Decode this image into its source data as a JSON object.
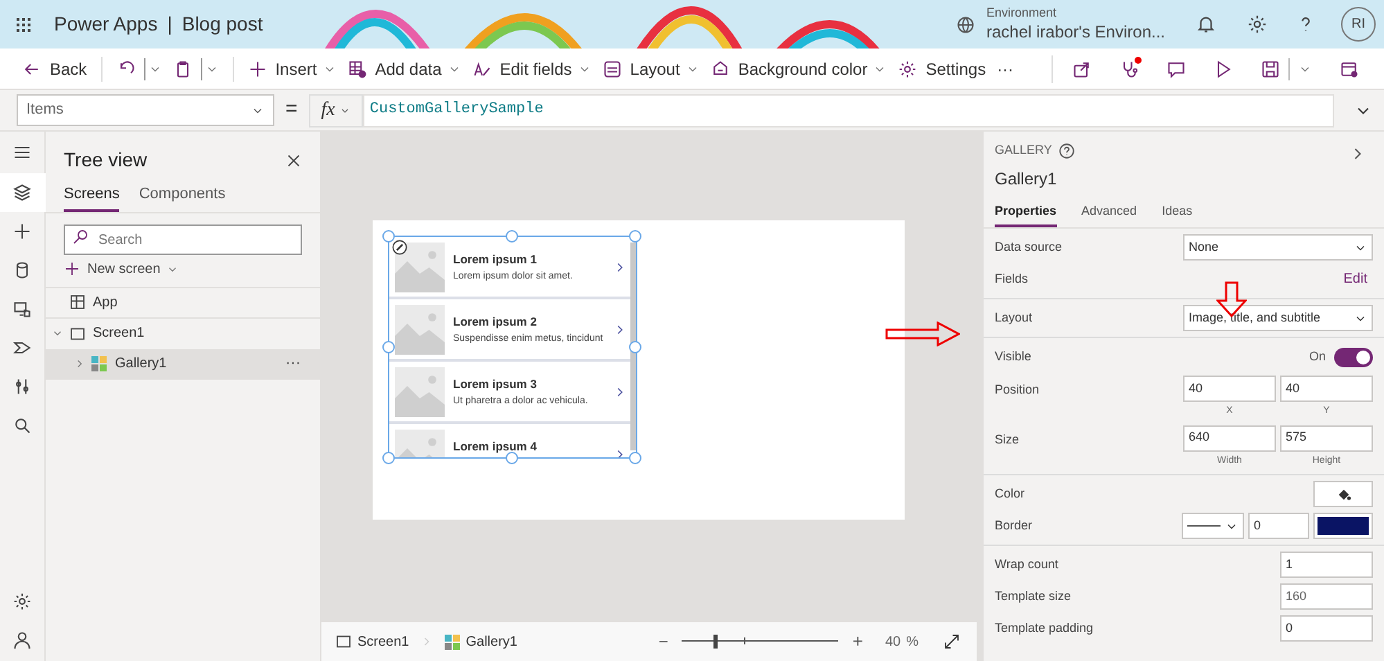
{
  "app_bar": {
    "app_name": "Power Apps",
    "separator": "|",
    "doc_title": "Blog post",
    "environment_label": "Environment",
    "environment_name": "rachel irabor's Environ...",
    "avatar_initials": "RI"
  },
  "toolbar": {
    "items": [
      {
        "label": "Back",
        "caret": false
      },
      {
        "caret": true
      },
      {
        "caret": true
      },
      {
        "label": "Insert",
        "caret": true
      },
      {
        "label": "Add data",
        "caret": true
      },
      {
        "label": "Edit fields",
        "caret": true
      },
      {
        "label": "Layout",
        "caret": true
      },
      {
        "label": "Background color",
        "caret": true
      },
      {
        "label": "Settings",
        "caret": false
      },
      {
        "label": "···",
        "caret": false
      }
    ]
  },
  "formula_bar": {
    "property": "Items",
    "equals": "=",
    "fx": "fx",
    "formula": "CustomGallerySample"
  },
  "left_rail": {
    "items": [
      {
        "selected": true
      },
      {
        "selected": false
      },
      {
        "selected": false
      },
      {
        "selected": false
      },
      {
        "selected": false
      },
      {
        "selected": false
      },
      {
        "selected": false
      }
    ]
  },
  "tree_view": {
    "title": "Tree view",
    "tabs": [
      {
        "label": "Screens",
        "selected": true
      },
      {
        "label": "Components",
        "selected": false
      }
    ],
    "search": {
      "placeholder": "Search"
    },
    "new_screen": "New screen",
    "nodes": [
      {
        "kind": "app",
        "label": "App",
        "selected": false
      },
      {
        "kind": "screen",
        "label": "Screen1",
        "selected": false,
        "expanded": true,
        "children": [
          {
            "kind": "gallery",
            "label": "Gallery1",
            "selected": true,
            "expanded": false,
            "more": "···"
          }
        ]
      }
    ]
  },
  "canvas": {
    "gallery_items": [
      {
        "title": "Lorem ipsum 1",
        "subtitle": "Lorem ipsum dolor sit amet."
      },
      {
        "title": "Lorem ipsum 2",
        "subtitle": "Suspendisse enim metus, tincidunt"
      },
      {
        "title": "Lorem ipsum 3",
        "subtitle": "Ut pharetra a dolor ac vehicula."
      },
      {
        "title": "Lorem ipsum 4"
      }
    ]
  },
  "properties_panel": {
    "type": "GALLERY",
    "name": "Gallery1",
    "tabs": [
      {
        "label": "Properties",
        "selected": true
      },
      {
        "label": "Advanced",
        "selected": false
      },
      {
        "label": "Ideas",
        "selected": false
      }
    ],
    "sections": [
      {
        "rows": [
          {
            "kind": "dropdown",
            "label": "Data source",
            "value": "None"
          },
          {
            "kind": "link",
            "label": "Fields",
            "link": "Edit"
          }
        ]
      },
      {
        "rows": [
          {
            "kind": "dropdown",
            "label": "Layout",
            "value": "Image, title, and subtitle"
          }
        ]
      },
      {
        "rows": [
          {
            "kind": "toggle",
            "label": "Visible",
            "state_text": "On",
            "on": true
          },
          {
            "kind": "pair",
            "label": "Position",
            "fields": [
              {
                "value": "40",
                "caption": "X"
              },
              {
                "value": "40",
                "caption": "Y"
              }
            ]
          },
          {
            "kind": "pair",
            "label": "Size",
            "fields": [
              {
                "value": "640",
                "caption": "Width"
              },
              {
                "value": "575",
                "caption": "Height"
              }
            ]
          }
        ]
      },
      {
        "rows": [
          {
            "kind": "color",
            "label": "Color"
          },
          {
            "kind": "border",
            "label": "Border",
            "value": "0",
            "color": "#0a1464"
          }
        ]
      },
      {
        "rows": [
          {
            "kind": "number",
            "label": "Wrap count",
            "value": "1",
            "disabled": false
          },
          {
            "kind": "number",
            "label": "Template size",
            "value": "160",
            "disabled": true
          },
          {
            "kind": "number",
            "label": "Template padding",
            "value": "0",
            "disabled": false
          }
        ]
      }
    ]
  },
  "status_bar": {
    "breadcrumbs": [
      {
        "kind": "screen",
        "label": "Screen1"
      },
      {
        "kind": "gallery",
        "label": "Gallery1"
      }
    ],
    "zoom_minus": "−",
    "zoom_plus": "+",
    "zoom": {
      "level": 0.21
    },
    "zoom_value": "40",
    "zoom_unit": "%"
  }
}
